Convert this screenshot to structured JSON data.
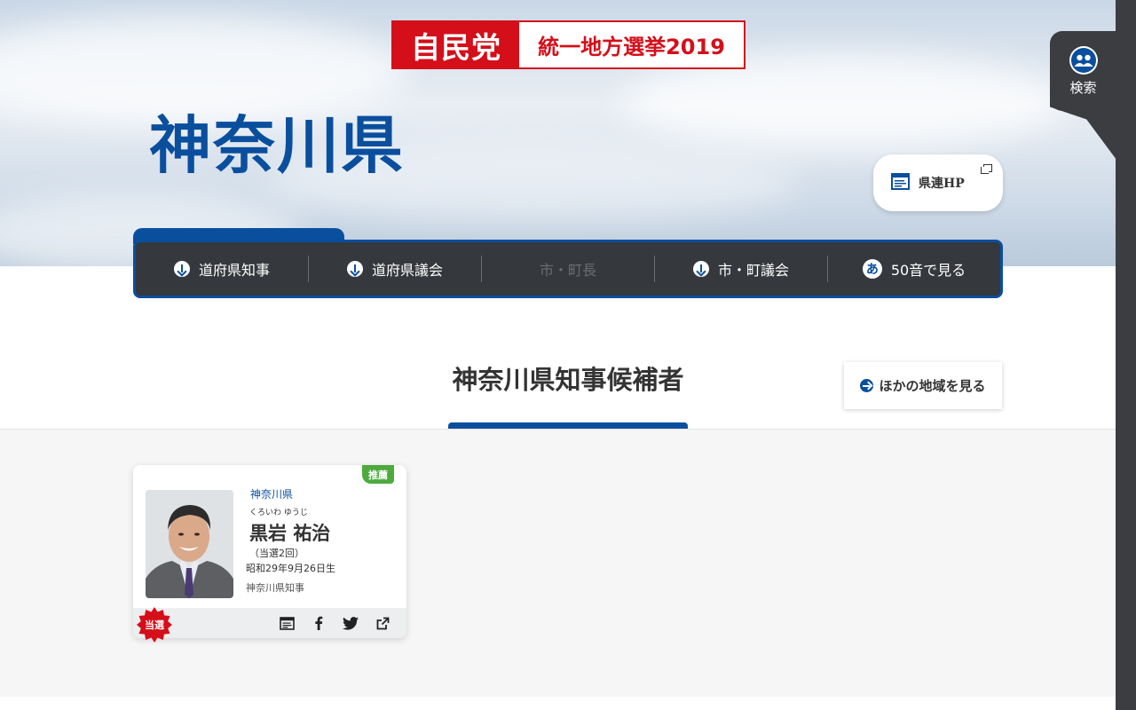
{
  "header": {
    "logo_party": "自民党",
    "logo_event": "統一地方選挙2019",
    "prefecture": "神奈川県",
    "pref_hp_label": "県連HP"
  },
  "search": {
    "label": "検索"
  },
  "nav": {
    "items": [
      {
        "label": "道府県知事",
        "icon": "arrow-down-circle-icon",
        "enabled": true
      },
      {
        "label": "道府県議会",
        "icon": "arrow-down-circle-icon",
        "enabled": true
      },
      {
        "label": "市・町長",
        "icon": "",
        "enabled": false
      },
      {
        "label": "市・町議会",
        "icon": "arrow-down-circle-icon",
        "enabled": true
      },
      {
        "label": "50音で見る",
        "icon": "hiragana-a-icon",
        "enabled": true
      }
    ]
  },
  "section": {
    "title": "神奈川県知事候補者",
    "other_regions_label": "ほかの地域を見る"
  },
  "candidate": {
    "badge": "推薦",
    "prefecture": "神奈川県",
    "kana": "くろいわ ゆうじ",
    "name": "黒岩 祐治",
    "elected_count": "（当選2回）",
    "birth": "昭和29年9月26日生",
    "role": "神奈川県知事",
    "result": "当選"
  },
  "colors": {
    "brand_red": "#d40f1a",
    "brand_blue": "#0a4f9e",
    "nav_bg": "#35383d",
    "recommend_green": "#4eaa3f"
  }
}
